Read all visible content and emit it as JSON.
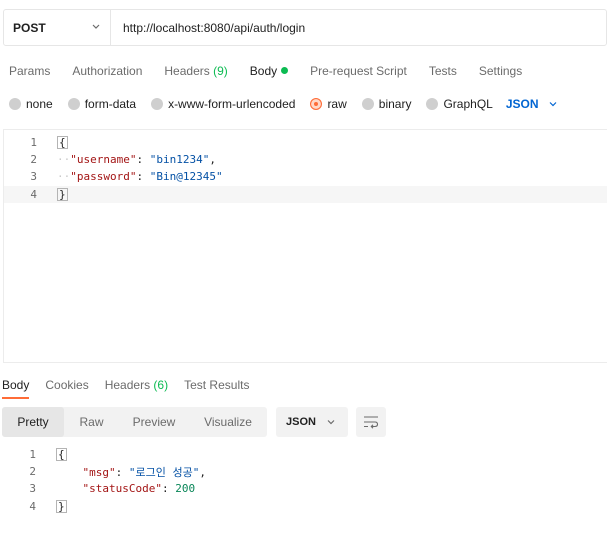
{
  "request": {
    "method": "POST",
    "url": "http://localhost:8080/api/auth/login"
  },
  "request_tabs": [
    {
      "label": "Params"
    },
    {
      "label": "Authorization"
    },
    {
      "label": "Headers",
      "count": "(9)"
    },
    {
      "label": "Body"
    },
    {
      "label": "Pre-request Script"
    },
    {
      "label": "Tests"
    },
    {
      "label": "Settings"
    }
  ],
  "body_types": [
    "none",
    "form-data",
    "x-www-form-urlencoded",
    "raw",
    "binary",
    "GraphQL"
  ],
  "body_format": "JSON",
  "editor": {
    "line_numbers": [
      "1",
      "2",
      "3",
      "4"
    ],
    "open_brace": "{",
    "close_brace": "}",
    "username_key": "\"username\"",
    "username_value": "\"bin1234\"",
    "password_key": "\"password\"",
    "password_value": "\"Bin@12345\""
  },
  "response_tabs": [
    {
      "label": "Body"
    },
    {
      "label": "Cookies"
    },
    {
      "label": "Headers",
      "count": "(6)"
    },
    {
      "label": "Test Results"
    }
  ],
  "view_modes": [
    "Pretty",
    "Raw",
    "Preview",
    "Visualize"
  ],
  "response_format": "JSON",
  "response": {
    "line_numbers": [
      "1",
      "2",
      "3",
      "4"
    ],
    "open_brace": "{",
    "close_brace": "}",
    "msg_key": "\"msg\"",
    "msg_value": "\"로그인 성공\"",
    "status_key": "\"statusCode\"",
    "status_value": "200"
  },
  "colors": {
    "accent": "#ff6c37",
    "active_dot": "#0cbb52",
    "link_blue": "#0265d2"
  }
}
